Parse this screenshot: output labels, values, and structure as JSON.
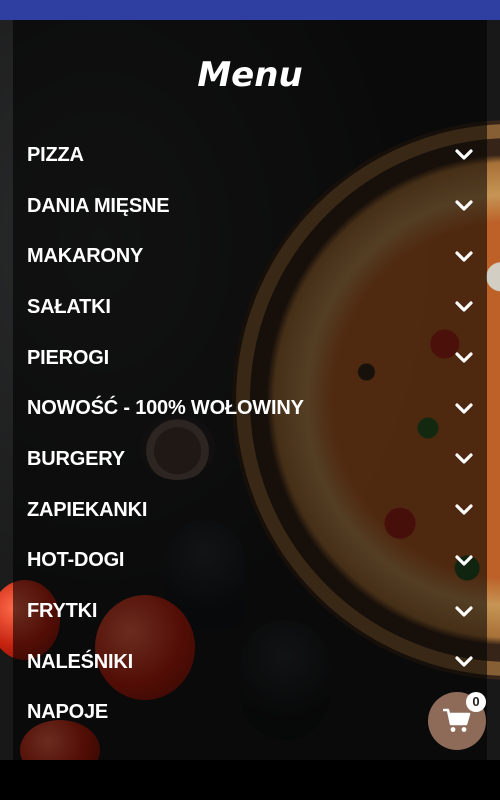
{
  "header": {
    "title": "Menu"
  },
  "categories": [
    {
      "label": "PIZZA",
      "icon": "chevron-down-icon"
    },
    {
      "label": "DANIA MIĘSNE",
      "icon": "chevron-down-icon"
    },
    {
      "label": "MAKARONY",
      "icon": "chevron-down-icon"
    },
    {
      "label": "SAŁATKI",
      "icon": "chevron-down-icon"
    },
    {
      "label": "PIEROGI",
      "icon": "chevron-down-icon"
    },
    {
      "label": "NOWOŚĆ - 100% WOŁOWINY",
      "icon": "chevron-down-icon"
    },
    {
      "label": "BURGERY",
      "icon": "chevron-down-icon"
    },
    {
      "label": "ZAPIEKANKI",
      "icon": "chevron-down-icon"
    },
    {
      "label": "HOT-DOGI",
      "icon": "chevron-down-icon"
    },
    {
      "label": "FRYTKI",
      "icon": "chevron-down-icon"
    },
    {
      "label": "NALEŚNIKI",
      "icon": "chevron-down-icon"
    },
    {
      "label": "NAPOJE",
      "icon": "chevron-down-icon"
    }
  ],
  "cart": {
    "count": "0",
    "icon": "shopping-cart-icon"
  },
  "colors": {
    "status_bar": "#2e3ea1",
    "text": "#ffffff",
    "cart_button": "#8e6a58",
    "badge": "#ffffff"
  }
}
